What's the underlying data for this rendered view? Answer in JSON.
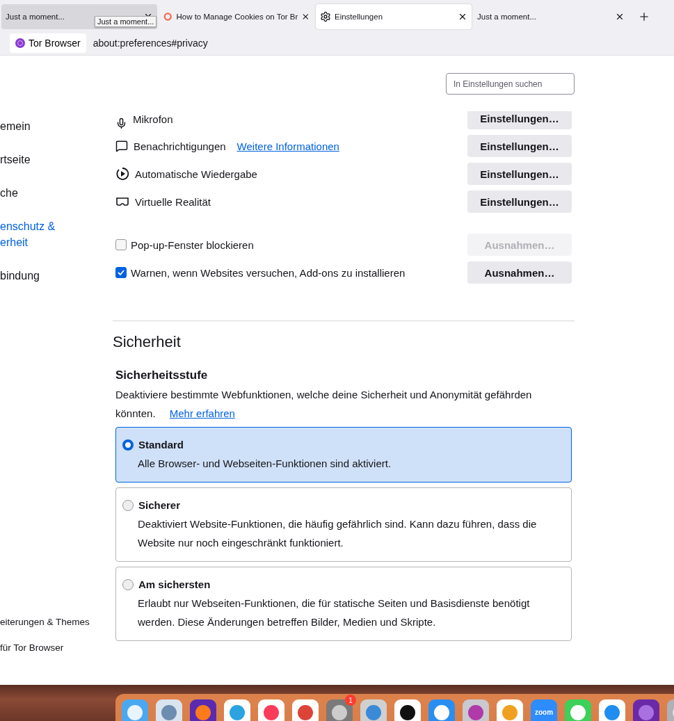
{
  "tabs": [
    {
      "title": "Just a moment...",
      "kind": "plain",
      "selected": false,
      "hovered": true
    },
    {
      "title": "How to Manage Cookies on Tor Br",
      "kind": "site",
      "selected": false,
      "hovered": false
    },
    {
      "title": "Einstellungen",
      "kind": "settings",
      "selected": true,
      "hovered": false
    },
    {
      "title": "Just a moment...",
      "kind": "plain",
      "selected": false,
      "hovered": false
    }
  ],
  "tooltip": "Just a moment...",
  "identity": {
    "label": "Tor Browser"
  },
  "url": "about:preferences#privacy",
  "search": {
    "placeholder": "In Einstellungen suchen"
  },
  "sidebar": {
    "items": [
      {
        "label": "emein",
        "selected": false
      },
      {
        "label": "rtseite",
        "selected": false
      },
      {
        "label": "che",
        "selected": false
      },
      {
        "label": "enschutz & erheit",
        "selected": true
      },
      {
        "label": "bindung",
        "selected": false
      }
    ],
    "footer_items": [
      {
        "label": "eiterungen & Themes"
      },
      {
        "label": "für Tor Browser"
      }
    ]
  },
  "permissions": [
    {
      "kind": "microphone",
      "label": "Mikrofon",
      "button": "Einstellungen…",
      "partial": true
    },
    {
      "kind": "notifications",
      "label": "Benachrichtigungen",
      "link": "Weitere Informationen",
      "button": "Einstellungen…",
      "partial": false
    },
    {
      "kind": "autoplay",
      "label": "Automatische Wiedergabe",
      "button": "Einstellungen…",
      "partial": false
    },
    {
      "kind": "vr",
      "label": "Virtuelle Realität",
      "button": "Einstellungen…",
      "partial": false
    }
  ],
  "options": [
    {
      "label": "Pop-up-Fenster blockieren",
      "checked": false,
      "button": "Ausnahmen…",
      "button_disabled": true
    },
    {
      "label": "Warnen, wenn Websites versuchen, Add-ons zu installieren",
      "checked": true,
      "button": "Ausnahmen…",
      "button_disabled": false
    }
  ],
  "security": {
    "heading": "Sicherheit",
    "subheading": "Sicherheitsstufe",
    "description": "Deaktiviere bestimmte Webfunktionen, welche deine Sicherheit und Anonymität gefährden könnten.",
    "link": "Mehr erfahren",
    "levels": [
      {
        "name": "Standard",
        "description": "Alle Browser- und Webseiten-Funktionen sind aktiviert.",
        "selected": true
      },
      {
        "name": "Sicherer",
        "description": "Deaktiviert Website-Funktionen, die häufig gefährlich sind. Kann dazu führen, dass die Website nur noch eingeschränkt funktioniert.",
        "selected": false
      },
      {
        "name": "Am sichersten",
        "description": "Erlaubt nur Webseiten-Funktionen, die für statische Seiten und Basisdienste benötigt werden. Diese Änderungen betreffen Bilder, Medien und Skripte.",
        "selected": false
      }
    ]
  },
  "dock": {
    "items": [
      {
        "kind": "finder"
      },
      {
        "kind": "mail"
      },
      {
        "kind": "firefox"
      },
      {
        "kind": "telegram"
      },
      {
        "kind": "music"
      },
      {
        "kind": "chrome"
      },
      {
        "kind": "prefs",
        "badge": "1"
      },
      {
        "kind": "dish"
      },
      {
        "kind": "capcut"
      },
      {
        "kind": "appstore"
      },
      {
        "kind": "imac"
      },
      {
        "kind": "photos"
      },
      {
        "kind": "zoom",
        "label": "zoom"
      },
      {
        "kind": "facetime"
      },
      {
        "kind": "safari"
      },
      {
        "kind": "tor"
      },
      {
        "kind": "generic"
      }
    ]
  }
}
